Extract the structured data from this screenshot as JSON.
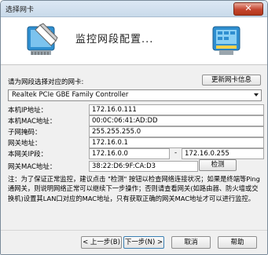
{
  "window": {
    "title": "选择网卡",
    "close_label": "✕"
  },
  "header": {
    "heading": "监控网段配置..."
  },
  "adapter": {
    "prompt": "请为网段选择对应的网卡:",
    "refresh_label": "更新网卡信息",
    "selected": "Realtek PCIe GBE Family Controller"
  },
  "fields": {
    "local_ip": {
      "label": "本机IP地址：",
      "value": "172.16.0.111"
    },
    "local_mac": {
      "label": "本机MAC地址：",
      "value": "00:0C:06:41:AD:DD"
    },
    "subnet_mask": {
      "label": "子网掩码：",
      "value": "255.255.255.0"
    },
    "gateway": {
      "label": "网关地址：",
      "value": "172.16.0.1"
    },
    "ip_range": {
      "label": "本网关IP段：",
      "start": "172.16.0.0",
      "separator": "-",
      "end": "172.16.0.255"
    },
    "gateway_mac": {
      "label": "网关MAC地址：",
      "value": "38:22:D6:9F:CA:D3",
      "detect_label": "检测"
    }
  },
  "note": "注：为了保证正常监控，建议点击 \"检测\" 按钮以检查网络连接状况；如果是终端等Ping通网关，则说明网络正常可以继续下一步操作；否则请查看网关(如路由器、防火墙或交换机)设置其LAN口对应的MAC地址，只有获取正确的网关MAC地址才可以进行监控。",
  "footer": {
    "back_label": "< 上一步(B)",
    "next_label": "下一步(N) >",
    "cancel_label": "取消",
    "help_label": "帮助"
  }
}
